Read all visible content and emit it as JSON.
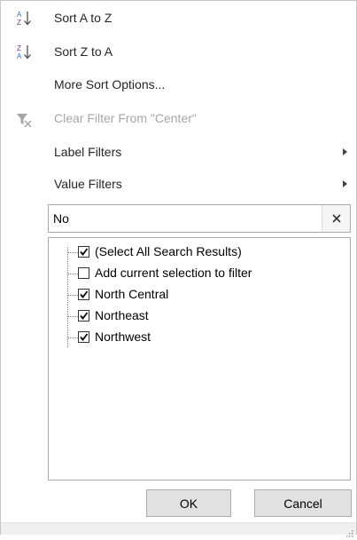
{
  "menu": {
    "sort_az": {
      "label": "Sort A to Z",
      "icon": "sort-ascending-icon"
    },
    "sort_za": {
      "label": "Sort Z to A",
      "icon": "sort-descending-icon"
    },
    "more_sort": {
      "label": "More Sort Options..."
    },
    "clear_filter": {
      "label": "Clear Filter From \"Center\"",
      "icon": "clear-filter-icon",
      "disabled": true
    },
    "label_filters": {
      "label": "Label Filters"
    },
    "value_filters": {
      "label": "Value Filters"
    }
  },
  "search": {
    "value": "No"
  },
  "list": {
    "items": [
      {
        "label": "(Select All Search Results)",
        "checked": true
      },
      {
        "label": "Add current selection to filter",
        "checked": false
      },
      {
        "label": "North Central",
        "checked": true
      },
      {
        "label": "Northeast",
        "checked": true
      },
      {
        "label": "Northwest",
        "checked": true
      }
    ]
  },
  "buttons": {
    "ok": "OK",
    "cancel": "Cancel"
  },
  "colors": {
    "text": "#262626",
    "disabled": "#a6a6a6",
    "border": "#aaaaaa",
    "button_bg": "#e1e1e1"
  }
}
